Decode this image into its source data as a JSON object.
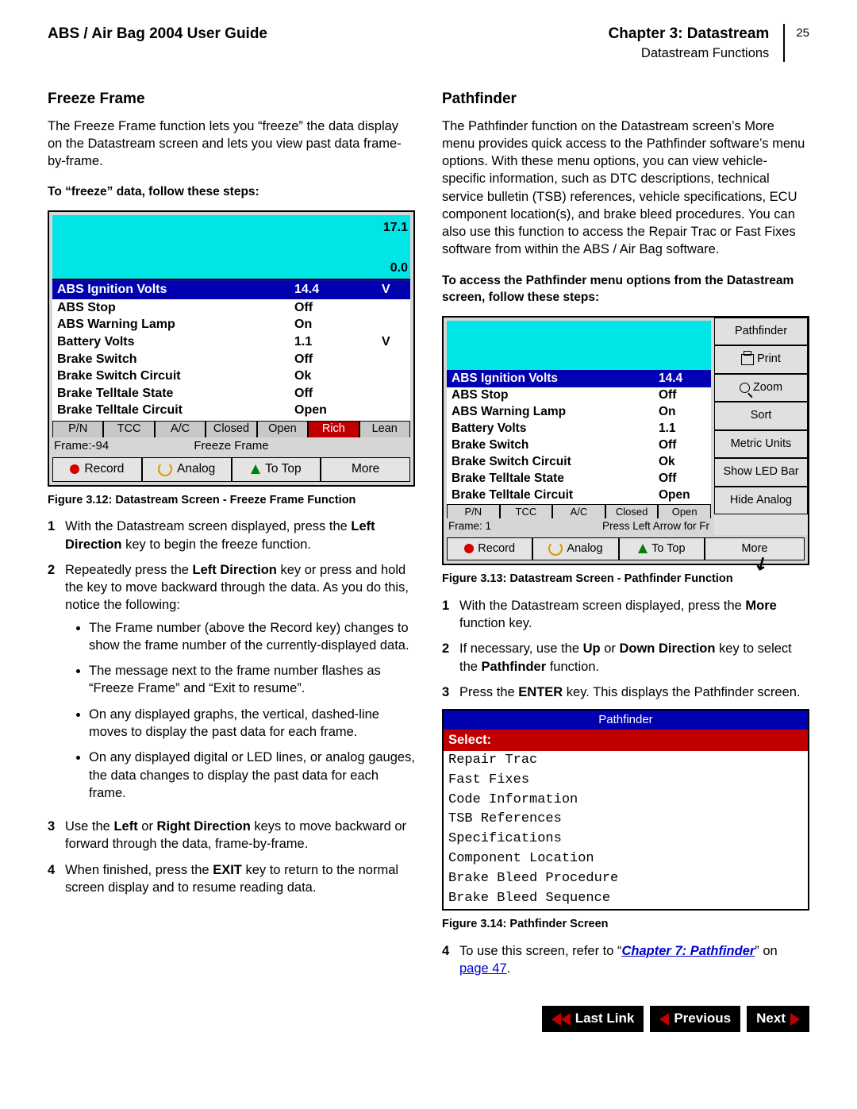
{
  "header": {
    "doc_title": "ABS / Air Bag 2004 User Guide",
    "chapter": "Chapter 3: Datastream",
    "section": "Datastream Functions",
    "page_num": "25"
  },
  "freeze": {
    "title": "Freeze Frame",
    "intro": "The Freeze Frame function lets you “freeze” the data display on the Datastream screen and lets you view past data frame-by-frame.",
    "subhead": "To “freeze” data, follow these steps:",
    "fig312_caption": "Figure 3.12: Datastream Screen - Freeze Frame Function",
    "graph_top": "17.1",
    "graph_zero": "0.0",
    "highlight": {
      "name": "ABS Ignition Volts",
      "val": "14.4",
      "unit": "V"
    },
    "rows": [
      {
        "name": "ABS Stop",
        "val": "Off",
        "unit": ""
      },
      {
        "name": "ABS Warning Lamp",
        "val": "On",
        "unit": ""
      },
      {
        "name": "Battery Volts",
        "val": "1.1",
        "unit": "V"
      },
      {
        "name": "Brake Switch",
        "val": "Off",
        "unit": ""
      },
      {
        "name": "Brake Switch Circuit",
        "val": "Ok",
        "unit": ""
      },
      {
        "name": "Brake Telltale State",
        "val": "Off",
        "unit": ""
      },
      {
        "name": "Brake Telltale Circuit",
        "val": "Open",
        "unit": ""
      }
    ],
    "tabs": [
      "P/N",
      "TCC",
      "A/C",
      "Closed",
      "Open",
      "Rich",
      "Lean"
    ],
    "frame_label": "Frame:-94",
    "frame_center": "Freeze Frame",
    "btns": [
      "Record",
      "Analog",
      "To Top",
      "More"
    ],
    "step1_a": "With the Datastream screen displayed, press the ",
    "step1_b": "Left Direction",
    "step1_c": " key to begin the freeze function.",
    "step2_a": "Repeatedly press the ",
    "step2_b": "Left Direction",
    "step2_c": " key or press and hold the key to move backward through the data. As you do this, notice the following:",
    "b1": "The Frame number (above the Record key) changes to show the frame number of the currently-displayed data.",
    "b2": "The message next to the frame number flashes as “Freeze Frame” and “Exit to resume”.",
    "b3": "On any displayed graphs, the vertical, dashed-line moves to display the past data for each frame.",
    "b4": "On any displayed digital or LED lines, or analog gauges, the data changes to display the past data for each frame.",
    "step3_a": "Use the ",
    "step3_b": "Left",
    "step3_c": " or ",
    "step3_d": "Right Direction",
    "step3_e": " keys to move backward or forward through the data, frame-by-frame.",
    "step4_a": "When finished, press the ",
    "step4_b": "EXIT",
    "step4_c": " key to return to the normal screen display and to resume reading data."
  },
  "pathfinder": {
    "title": "Pathfinder",
    "intro": "The Pathfinder function on the Datastream screen’s More menu provides quick access to the Pathfinder software’s menu options. With these menu options, you can view vehicle-specific information, such as DTC descriptions, technical service bulletin (TSB) references, vehicle specifications, ECU component location(s), and brake bleed procedures. You can also use this function to access the Repair Trac or Fast Fixes software from within the ABS / Air Bag software.",
    "subhead": "To access the Pathfinder menu options from the Datastream screen, follow these steps:",
    "highlight": {
      "name": "ABS Ignition Volts",
      "val": "14.4"
    },
    "rows": [
      {
        "name": "ABS Stop",
        "val": "Off"
      },
      {
        "name": "ABS Warning Lamp",
        "val": "On"
      },
      {
        "name": "Battery Volts",
        "val": "1.1"
      },
      {
        "name": "Brake Switch",
        "val": "Off"
      },
      {
        "name": "Brake Switch Circuit",
        "val": "Ok"
      },
      {
        "name": "Brake Telltale State",
        "val": "Off"
      },
      {
        "name": "Brake Telltale Circuit",
        "val": "Open"
      }
    ],
    "tabs": [
      "P/N",
      "TCC",
      "A/C",
      "Closed",
      "Open"
    ],
    "frame_label": "Frame: 1",
    "frame_msg": "Press Left Arrow for Fr",
    "menu": [
      "Pathfinder",
      "Print",
      "Zoom",
      "Sort",
      "Metric Units",
      "Show LED Bar",
      "Hide Analog"
    ],
    "btns": [
      "Record",
      "Analog",
      "To Top",
      "More"
    ],
    "fig313_caption": "Figure 3.13:  Datastream Screen - Pathfinder Function",
    "step1_a": "With the Datastream screen displayed, press the ",
    "step1_b": "More",
    "step1_c": " function key.",
    "step2_a": "If necessary, use the ",
    "step2_b": "Up",
    "step2_c": " or ",
    "step2_d": "Down Direction",
    "step2_e": " key to select the ",
    "step2_f": "Pathfinder",
    "step2_g": " function.",
    "step3_a": "Press the ",
    "step3_b": "ENTER",
    "step3_c": " key. This displays the Pathfinder screen.",
    "pf_title": "Pathfinder",
    "pf_select": "Select:",
    "pf_items": [
      "Repair Trac",
      "Fast Fixes",
      "Code Information",
      "TSB References",
      "Specifications",
      "Component Location",
      "Brake Bleed Procedure",
      "Brake Bleed Sequence"
    ],
    "fig314_caption": "Figure 3.14: Pathfinder Screen",
    "step4_a": "To use this screen, refer to “",
    "step4_link": "Chapter 7: Pathfinder",
    "step4_b": "” on ",
    "step4_page": "page 47",
    "step4_c": "."
  },
  "nav": {
    "last": "Last Link",
    "prev": "Previous",
    "next": "Next"
  }
}
